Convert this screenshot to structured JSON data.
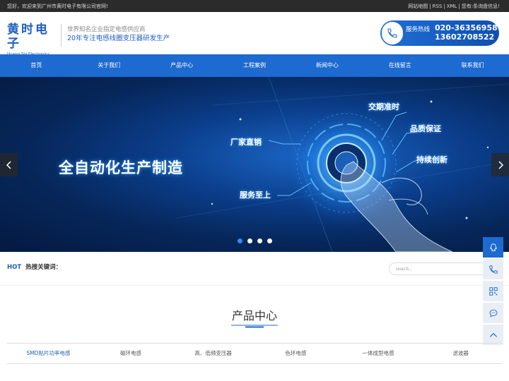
{
  "topbar": {
    "welcome": "您好，欢迎来到广州市黄时电子有限公司官网!",
    "links": [
      "网站地图",
      "RSS",
      "XML",
      "您有:条询盘信息!"
    ]
  },
  "header": {
    "logo_cn": "黄时电子",
    "logo_en": "Huang Shi Electronics",
    "slogan_line1": "世界知名企业指定电感供应商",
    "slogan_line2": "20年专注电感线圈变压器研发生产",
    "hotline_label": "服务热线",
    "hotline_number1": "020-36356958",
    "hotline_number2": "13602708522"
  },
  "nav": [
    "首页",
    "关于我们",
    "产品中心",
    "工程案例",
    "新闻中心",
    "在线留言",
    "联系我们"
  ],
  "banner": {
    "headline": "全自动化生产制造",
    "tags": [
      "交期准时",
      "品质保证",
      "厂家直销",
      "持续创新",
      "服务至上"
    ],
    "slide_count": 4,
    "active_slide": 1
  },
  "hot_keywords": {
    "prefix": "HOT",
    "label": "热搜关键词：",
    "search_placeholder": "search..."
  },
  "sidebar_icons": [
    "qq-icon",
    "phone-icon",
    "qrcode-icon",
    "message-icon",
    "back-to-top-icon"
  ],
  "products": {
    "title": "产品中心",
    "tabs": [
      "SMD贴片功率电感",
      "磁环电感",
      "高、低频变压器",
      "色环电感",
      "一体成型电感",
      "滤波器"
    ],
    "active_tab": 0
  },
  "colors": {
    "primary": "#1d6ad0",
    "topbar": "#2b2b2b",
    "banner_dark": "#062659"
  }
}
